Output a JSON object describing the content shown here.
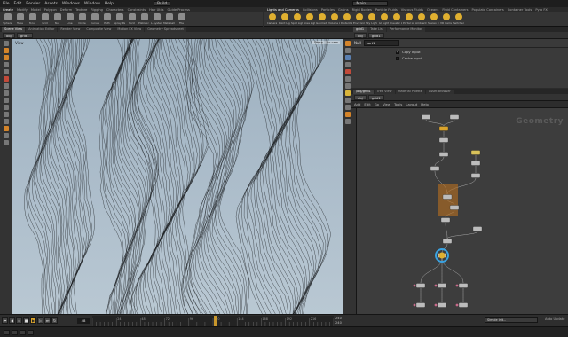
{
  "menubar": {
    "items": [
      "File",
      "Edit",
      "Render",
      "Assets",
      "Windows",
      "Window",
      "Help"
    ],
    "build_label": "Build",
    "desktop_label": "Main"
  },
  "shelf_left": {
    "tabs": [
      "Create",
      "Modify",
      "Model",
      "Polygon",
      "Deform",
      "Texture",
      "Rigging",
      "Characters",
      "Constraints",
      "Hair Utils",
      "Guide Process",
      "Terrain FX",
      "Cloud FX",
      "Volume"
    ],
    "tools": [
      "Sphere",
      "Tube",
      "Torus",
      "Grid",
      "Null",
      "Line",
      "Circle",
      "Curve",
      "Path",
      "Spray Paint",
      "Font",
      "Platonic Solids",
      "L-System",
      "Metaball",
      "File"
    ]
  },
  "shelf_right": {
    "tabs": [
      "Lights and Cameras",
      "Collisions",
      "Particles",
      "Grains",
      "Rigid Bodies",
      "Particle Fluids",
      "Viscous Fluids",
      "Oceans",
      "Fluid Containers",
      "Populate Containers",
      "Container Tools",
      "Pyro FX",
      "FEM",
      "Wires",
      "Crowds",
      "Drive Simulation"
    ],
    "tools": [
      "Camera",
      "Point Light",
      "Spot Light",
      "Area Light",
      "Geometry Light",
      "Volume Light",
      "Distant Light",
      "Environment Light",
      "Sky Light",
      "GI Light",
      "Caustic Light",
      "Portal Light",
      "Ambient Light",
      "Stereo Camera",
      "VR Camera",
      "Switcher"
    ]
  },
  "viewport": {
    "tabs": [
      "Scene View",
      "Animation Editor",
      "Render View",
      "Composite View",
      "Motion FX View",
      "Geometry Spreadsheet"
    ],
    "path": [
      "obj",
      "grid1"
    ],
    "title": "View",
    "camera_label": "Persp",
    "display_label": "No cam"
  },
  "timeline": {
    "current_frame": "48",
    "range_start": "240",
    "range_end": "240",
    "ticks": [
      "24",
      "48",
      "72",
      "96",
      "120",
      "144",
      "168",
      "192",
      "216"
    ]
  },
  "parameters": {
    "tabs": [
      "grid1",
      "Take List",
      "Performance Monitor"
    ],
    "path": [
      "obj",
      "grid1"
    ],
    "node_type_label": "Null",
    "node_name": "sort1",
    "checkboxes": [
      {
        "label": "Copy Input",
        "checked": true
      },
      {
        "label": "Cache Input",
        "checked": false
      }
    ]
  },
  "network": {
    "tabs": [
      "/obj/grid1",
      "Tree View",
      "Material Palette",
      "Asset Browser"
    ],
    "path": [
      "obj",
      "grid1"
    ],
    "menu": [
      "Add",
      "Edit",
      "Go",
      "View",
      "Tools",
      "Layout",
      "Help"
    ],
    "context_label": "Geometry"
  },
  "status": {
    "message": "Simple Init...",
    "mode": "Auto Update"
  },
  "colors": {
    "accent": "#d9a32c",
    "viewport_top": "#9eb1c0",
    "viewport_bottom": "#b9c8d3",
    "network_bg": "#3d3d3d",
    "display_flag": "#3aa2e0",
    "wire": "#a8a8a8"
  }
}
